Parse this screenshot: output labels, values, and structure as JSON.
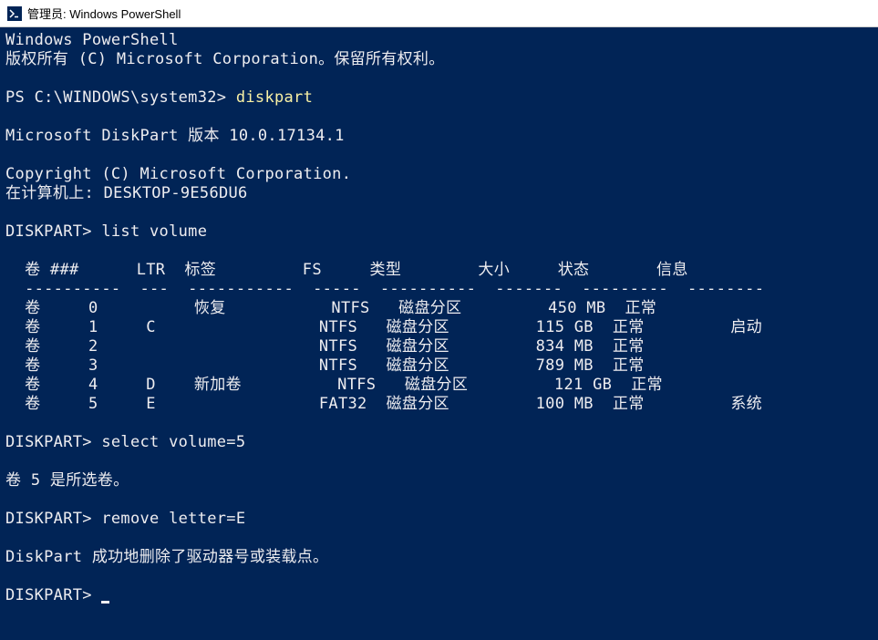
{
  "titlebar": {
    "icon_text": ">_",
    "title": "管理员: Windows PowerShell"
  },
  "terminal": {
    "line1": "Windows PowerShell",
    "line2": "版权所有 (C) Microsoft Corporation。保留所有权利。",
    "blank1": "",
    "prompt1_prefix": "PS C:\\WINDOWS\\system32> ",
    "prompt1_cmd": "diskpart",
    "blank2": "",
    "dp_version": "Microsoft DiskPart 版本 10.0.17134.1",
    "blank3": "",
    "dp_copyright": "Copyright (C) Microsoft Corporation.",
    "dp_computer": "在计算机上: DESKTOP-9E56DU6",
    "blank4": "",
    "dp_prompt1": "DISKPART> list volume",
    "blank5": "",
    "hdr": "  卷 ###      LTR  标签         FS     类型        大小     状态       信息",
    "sep": "  ----------  ---  -----------  -----  ----------  -------  ---------  --------",
    "row0": "  卷     0          恢复           NTFS   磁盘分区         450 MB  正常",
    "row1": "  卷     1     C                 NTFS   磁盘分区         115 GB  正常         启动",
    "row2": "  卷     2                       NTFS   磁盘分区         834 MB  正常",
    "row3": "  卷     3                       NTFS   磁盘分区         789 MB  正常",
    "row4": "  卷     4     D    新加卷          NTFS   磁盘分区         121 GB  正常",
    "row5": "  卷     5     E                 FAT32  磁盘分区         100 MB  正常         系统",
    "blank6": "",
    "dp_prompt2": "DISKPART> select volume=5",
    "blank7": "",
    "select_result": "卷 5 是所选卷。",
    "blank8": "",
    "dp_prompt3": "DISKPART> remove letter=E",
    "blank9": "",
    "remove_result": "DiskPart 成功地删除了驱动器号或装载点。",
    "blank10": "",
    "dp_prompt4": "DISKPART> "
  }
}
